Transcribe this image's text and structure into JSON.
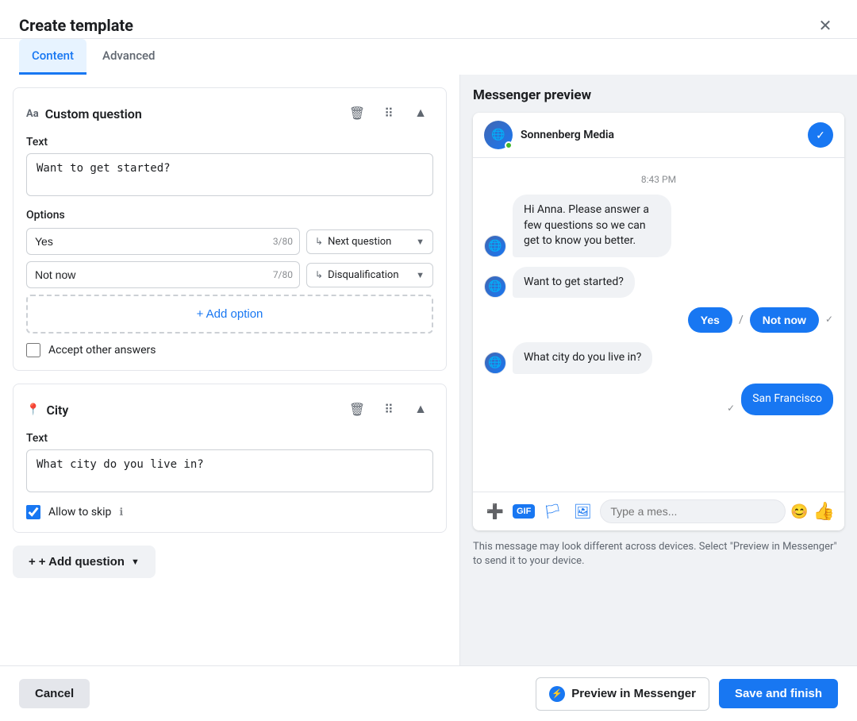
{
  "header": {
    "title": "Create template",
    "close_label": "×"
  },
  "tabs": [
    {
      "id": "content",
      "label": "Content",
      "active": true
    },
    {
      "id": "advanced",
      "label": "Advanced",
      "active": false
    }
  ],
  "custom_question_card": {
    "title": "Custom question",
    "text_label": "Text",
    "text_value": "Want to get started?",
    "options_label": "Options",
    "options": [
      {
        "value": "Yes",
        "char_count": "3/80",
        "route": "Next question"
      },
      {
        "value": "Not now",
        "char_count": "7/80",
        "route": "Disqualification"
      }
    ],
    "add_option_label": "+ Add option",
    "accept_other_label": "Accept other answers"
  },
  "city_card": {
    "title": "City",
    "text_label": "Text",
    "text_value": "What city do you live in?",
    "allow_skip_label": "Allow to skip"
  },
  "add_question": {
    "label": "+ Add question"
  },
  "messenger_preview": {
    "title": "Messenger preview",
    "page_name": "Sonnenberg Media",
    "timestamp": "8:43 PM",
    "messages": [
      {
        "type": "bot",
        "text": "Hi Anna. Please answer a few questions so we can get to know you better."
      },
      {
        "type": "bot",
        "text": "Want to get started?"
      },
      {
        "type": "quick_reply",
        "options": [
          "Yes",
          "Not now"
        ]
      },
      {
        "type": "bot",
        "text": "What city do you live in?"
      },
      {
        "type": "user",
        "text": "San Francisco"
      }
    ],
    "input_placeholder": "Type a mes...",
    "preview_note": "This message may look different across devices. Select \"Preview in Messenger\" to send it to your device."
  },
  "footer": {
    "cancel_label": "Cancel",
    "preview_messenger_label": "Preview in Messenger",
    "save_label": "Save and finish"
  }
}
